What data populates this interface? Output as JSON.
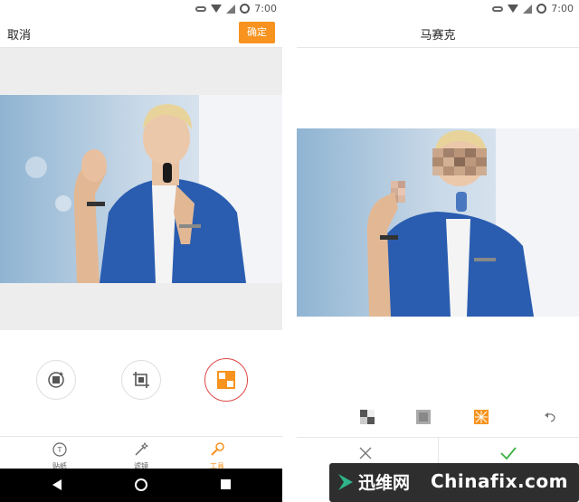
{
  "status": {
    "time_left": "7:00",
    "time_right": "7:00"
  },
  "left": {
    "cancel_label": "取消",
    "confirm_label": "确定",
    "tabs": [
      {
        "label": "贴纸",
        "icon": "sticker-icon",
        "active": false
      },
      {
        "label": "滤镜",
        "icon": "magic-wand-icon",
        "active": false
      },
      {
        "label": "工具",
        "icon": "wrench-icon",
        "active": true
      }
    ],
    "tools": [
      {
        "icon": "rotate-icon",
        "active": false
      },
      {
        "icon": "crop-icon",
        "active": false
      },
      {
        "icon": "mosaic-icon",
        "active": true
      }
    ]
  },
  "right": {
    "title": "马赛克",
    "modes": [
      {
        "icon": "mosaic-checker-icon",
        "active": false
      },
      {
        "icon": "mosaic-blur-icon",
        "active": false
      },
      {
        "icon": "mosaic-pattern-icon",
        "active": true
      },
      {
        "icon": "undo-icon",
        "active": false
      }
    ],
    "cancel_icon": "close-icon",
    "confirm_icon": "check-icon"
  },
  "watermark": {
    "text_a": "迅维网",
    "text_b": "Chinafix.com"
  },
  "colors": {
    "accent": "#f7931e",
    "active_ring": "#e04848",
    "confirm_check": "#3cb043",
    "jacket": "#2a5db0"
  }
}
